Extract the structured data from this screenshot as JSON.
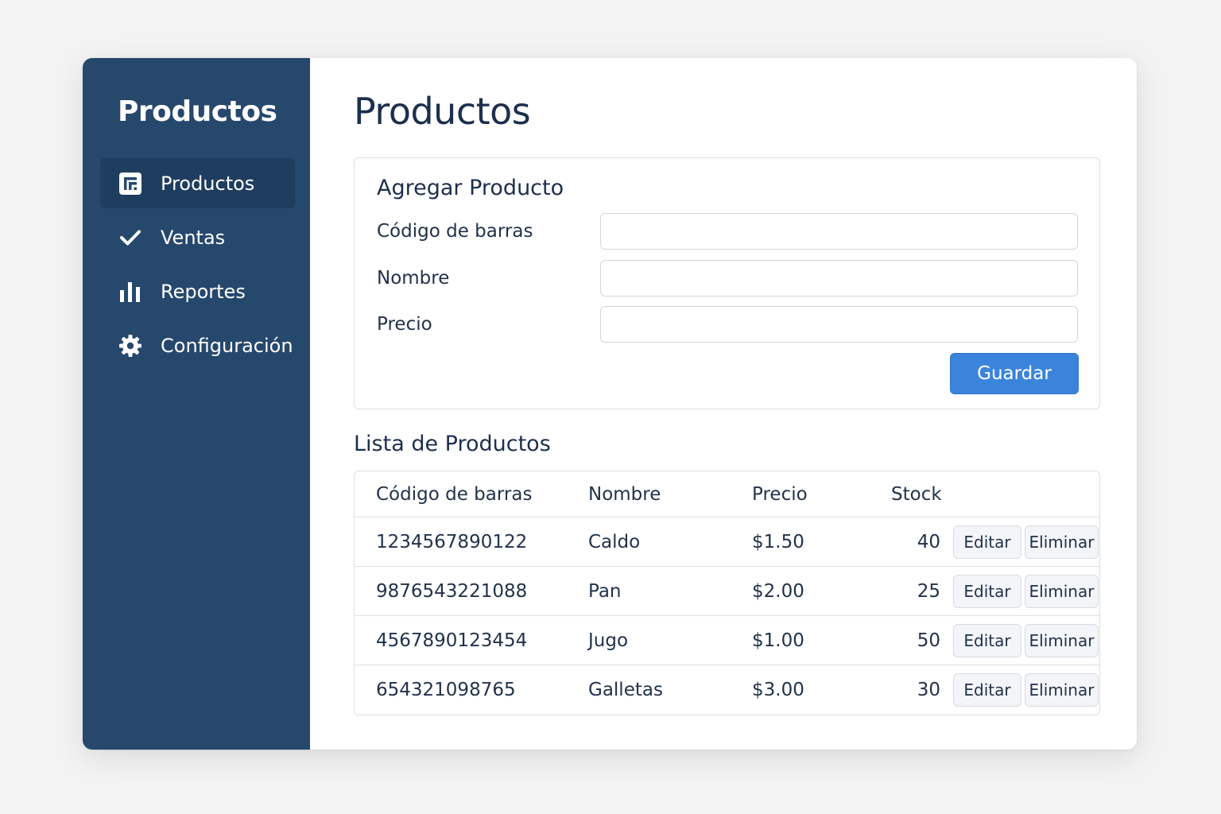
{
  "sidebar": {
    "title": "Productos",
    "items": [
      {
        "label": "Productos",
        "icon": "products-icon",
        "active": true
      },
      {
        "label": "Ventas",
        "icon": "check-icon",
        "active": false
      },
      {
        "label": "Reportes",
        "icon": "bar-chart-icon",
        "active": false
      },
      {
        "label": "Configuración",
        "icon": "gear-icon",
        "active": false
      }
    ]
  },
  "main": {
    "title": "Productos",
    "form": {
      "title": "Agregar Producto",
      "fields": [
        {
          "label": "Código de barras",
          "value": "",
          "placeholder": ""
        },
        {
          "label": "Nombre",
          "value": "",
          "placeholder": ""
        },
        {
          "label": "Precio",
          "value": "",
          "placeholder": ""
        }
      ],
      "save_label": "Guardar"
    },
    "list": {
      "title": "Lista de Productos",
      "columns": [
        "Código de barras",
        "Nombre",
        "Precio",
        "Stock"
      ],
      "rows": [
        {
          "code": "1234567890122",
          "name": "Caldo",
          "price": "$1.50",
          "stock": "40"
        },
        {
          "code": "9876543221088",
          "name": "Pan",
          "price": "$2.00",
          "stock": "25"
        },
        {
          "code": "4567890123454",
          "name": "Jugo",
          "price": "$1.00",
          "stock": "50"
        },
        {
          "code": "654321098765",
          "name": "Galletas",
          "price": "$3.00",
          "stock": "30"
        }
      ],
      "edit_label": "Editar",
      "delete_label": "Eliminar"
    }
  },
  "colors": {
    "sidebar_bg": "#26486d",
    "sidebar_active_bg": "#1f3d5f",
    "primary_button": "#3a84db",
    "title_text": "#1c2f4d"
  }
}
